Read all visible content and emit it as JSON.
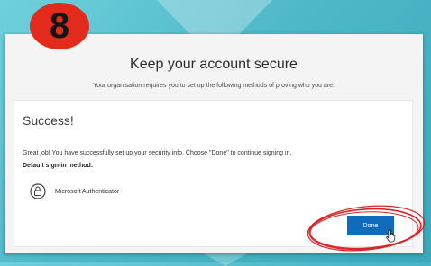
{
  "step_badge": "8",
  "page": {
    "title": "Keep your account secure",
    "subtitle": "Your organisation requires you to set up the following methods of proving who you are."
  },
  "success": {
    "heading": "Success!",
    "message": "Great job! You have successfully set up your security info. Choose \"Done\" to continue signing in.",
    "default_label": "Default sign-in method:",
    "method": "Microsoft Authenticator"
  },
  "actions": {
    "done_label": "Done"
  },
  "icons": {
    "method": "authenticator-lock-icon",
    "cursor": "hand-pointer-icon",
    "highlight": "red-circle-annotation"
  },
  "colors": {
    "badge": "#e22b1c",
    "button": "#0f6cbd",
    "background": "#4fb8c8",
    "annotation": "#d8262a"
  }
}
